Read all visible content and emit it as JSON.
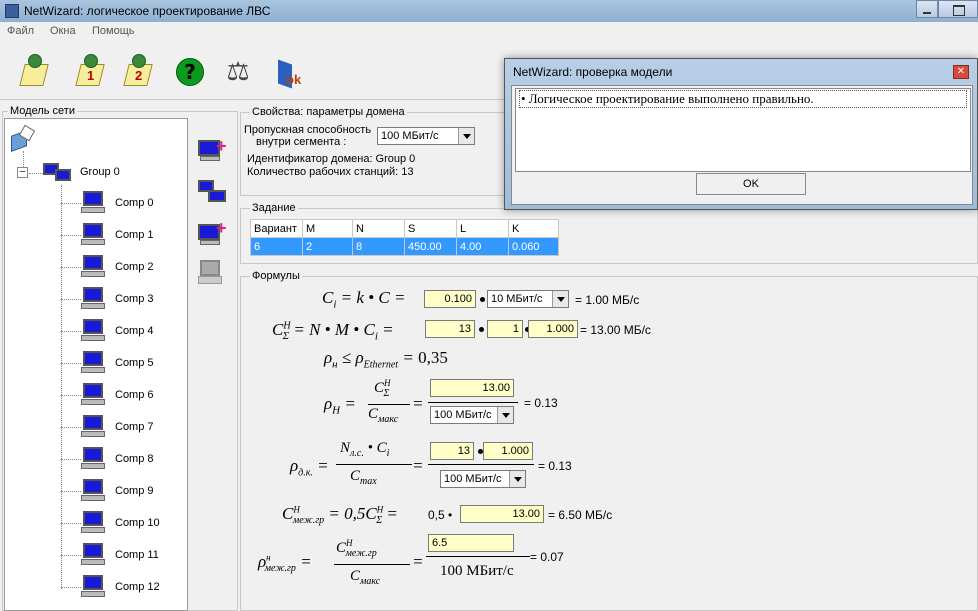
{
  "window": {
    "title": "NetWizard: логическое проектирование ЛВС"
  },
  "menu": [
    "Файл",
    "Окна",
    "Помощь"
  ],
  "toolbar": {
    "icons": [
      "new-task-icon",
      "step-1-icon",
      "step-2-icon",
      "help-icon",
      "check-model-icon",
      "ok-icon"
    ],
    "digit1": "1",
    "digit2": "2",
    "help": "?",
    "ok": "ok"
  },
  "tree": {
    "panel_label": "Модель сети",
    "group": "Group 0",
    "items": [
      "Comp 0",
      "Comp 1",
      "Comp 2",
      "Comp 3",
      "Comp 4",
      "Comp 5",
      "Comp 6",
      "Comp 7",
      "Comp 8",
      "Comp 9",
      "Comp 10",
      "Comp 11",
      "Comp 12"
    ]
  },
  "props": {
    "label": "Свойства: параметры домена",
    "bw_label_1": "Пропускная способность",
    "bw_label_2": "внутри сегмента :",
    "bw_value": "100 МБит/с",
    "domain_id": "Идентификатор домена: Group 0",
    "ws_count": "Количество рабочих станций: 13"
  },
  "task": {
    "label": "Задание",
    "headers": [
      "Вариант",
      "M",
      "N",
      "S",
      "L",
      "K"
    ],
    "row": [
      "6",
      "2",
      "8",
      "450.00",
      "4.00",
      "0.060"
    ]
  },
  "formulas": {
    "label": "Формулы",
    "f1": {
      "k": "0.100",
      "c": "10 МБит/с",
      "result": "= 1.00 МБ/с"
    },
    "f2": {
      "n": "13",
      "m": "1",
      "ci": "1.000",
      "result": "= 13.00 МБ/с"
    },
    "f3": {
      "text": "0,35"
    },
    "f4": {
      "num": "13.00",
      "den": "100 МБит/с",
      "result": "= 0.13"
    },
    "f5": {
      "n": "13",
      "ci": "1.000",
      "den": "100 МБит/с",
      "result": "= 0.13"
    },
    "f6": {
      "coef": "0,5 •",
      "val": "13.00",
      "result": "= 6.50 МБ/с"
    },
    "f7": {
      "num": "6.5",
      "den": "100 МБит/с",
      "result": "= 0.07"
    }
  },
  "dialog": {
    "title": "NetWizard: проверка модели",
    "message": "• Логическое проектирование выполнено правильно.",
    "ok": "OK"
  }
}
